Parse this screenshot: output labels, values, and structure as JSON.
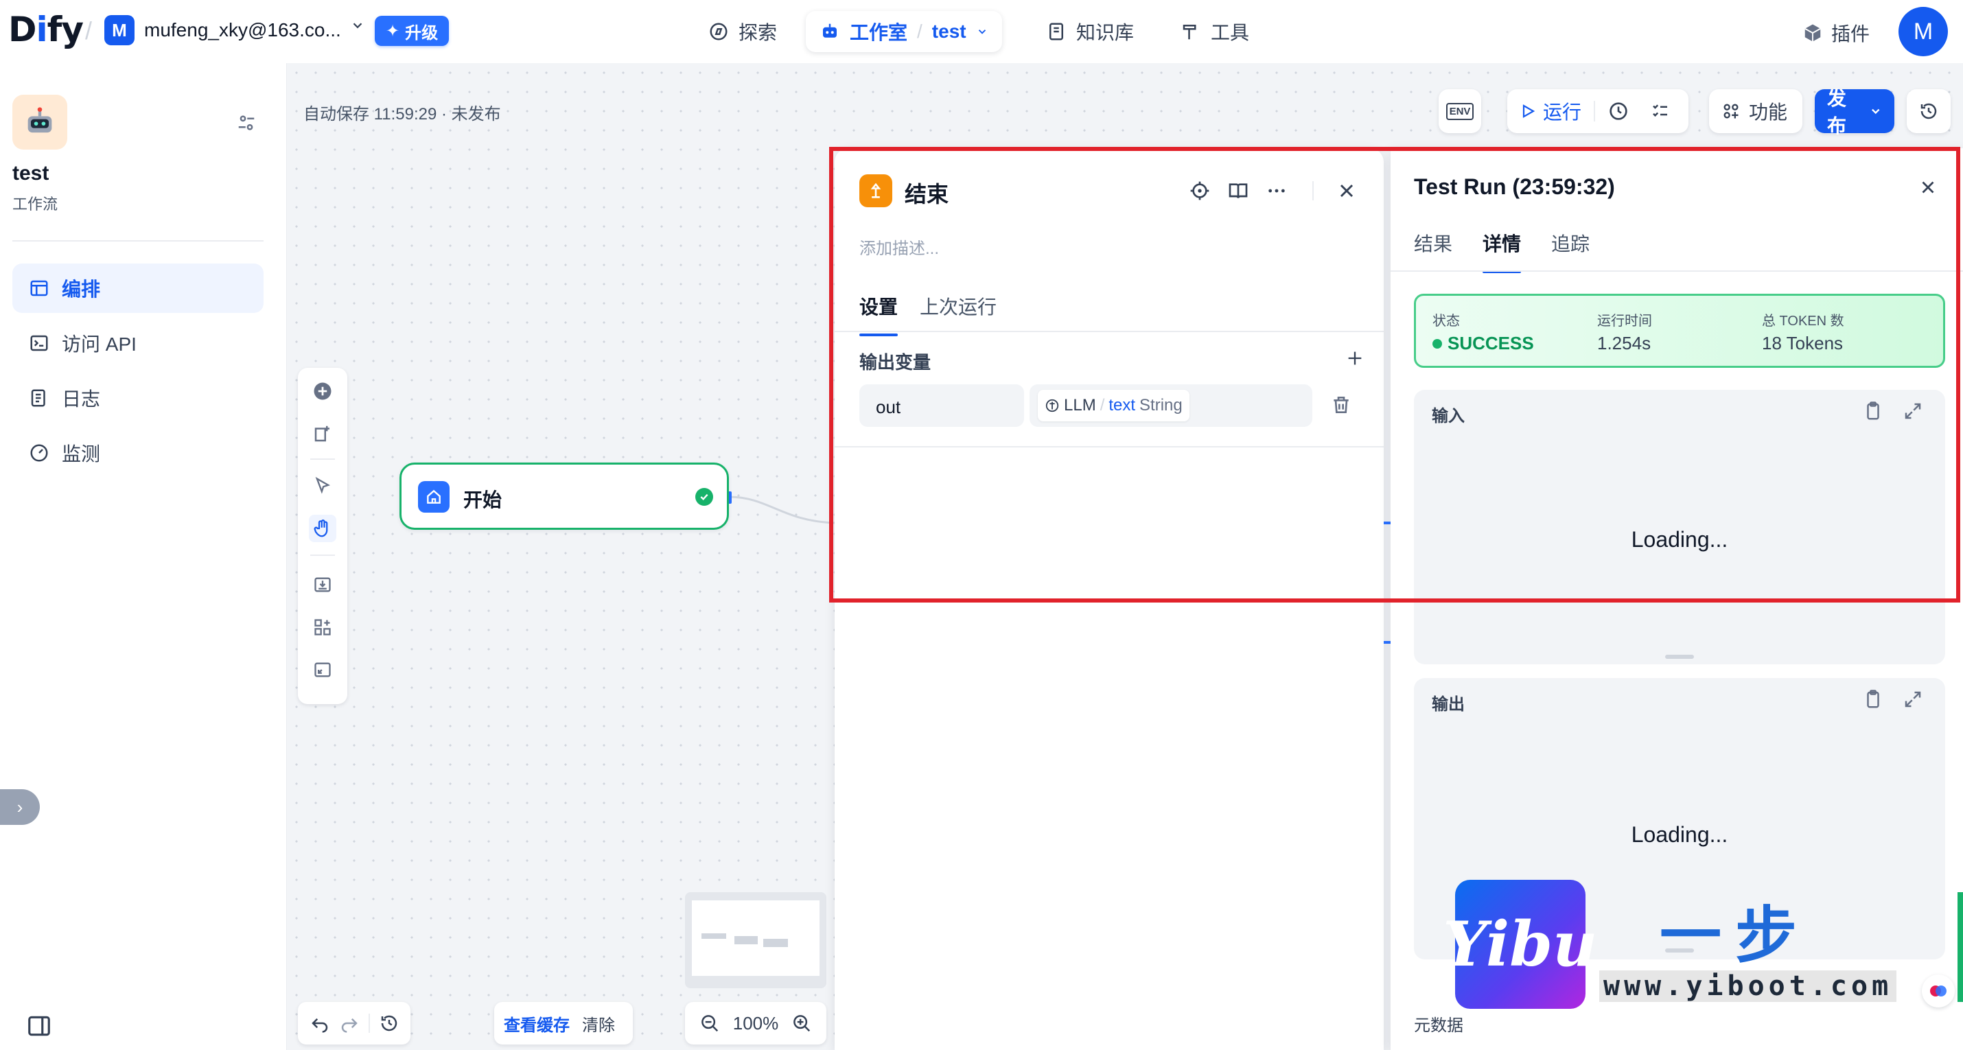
{
  "brand": {
    "logo": "Dify"
  },
  "workspace": {
    "avatar": "M",
    "name": "mufeng_xky@163.co...",
    "upgrade_label": "升级"
  },
  "nav": {
    "explore": "探索",
    "studio": "工作室",
    "app": "test",
    "knowledge": "知识库",
    "tools": "工具"
  },
  "header": {
    "plugins": "插件",
    "user_avatar": "M"
  },
  "sidebar": {
    "app_title": "test",
    "app_type": "工作流",
    "items": [
      {
        "label": "编排",
        "icon": "layout-icon"
      },
      {
        "label": "访问 API",
        "icon": "terminal-icon"
      },
      {
        "label": "日志",
        "icon": "file-list-icon"
      },
      {
        "label": "监测",
        "icon": "gauge-icon"
      }
    ]
  },
  "canvas": {
    "autosave": "自动保存 11:59:29 · 未发布",
    "env": "ENV",
    "run": "运行",
    "features": "功能",
    "publish": "发布",
    "start_node": "开始",
    "view_cache": "查看缓存",
    "clear": "清除",
    "zoom": "100%"
  },
  "end_panel": {
    "title": "结束",
    "description_placeholder": "添加描述...",
    "tabs": [
      "设置",
      "上次运行"
    ],
    "section_title": "输出变量",
    "var_name": "out",
    "var_source": "LLM",
    "var_field": "text",
    "var_type": "String"
  },
  "run_panel": {
    "title": "Test Run (23:59:32)",
    "tabs": [
      "结果",
      "详情",
      "追踪"
    ],
    "status_label": "状态",
    "status_value": "SUCCESS",
    "time_label": "运行时间",
    "time_value": "1.254s",
    "tokens_label": "总 TOKEN 数",
    "tokens_value": "18 Tokens",
    "input_title": "输入",
    "input_loading": "Loading...",
    "output_title": "输出",
    "output_loading": "Loading...",
    "metadata_title": "元数据"
  },
  "watermark": {
    "logo_text": "Yibu",
    "cn": "一步",
    "url": "www.yiboot.com"
  },
  "colors": {
    "accent": "#155aef",
    "success": "#17b26a",
    "highlight": "#e1222b",
    "node_orange": "#f79009"
  }
}
